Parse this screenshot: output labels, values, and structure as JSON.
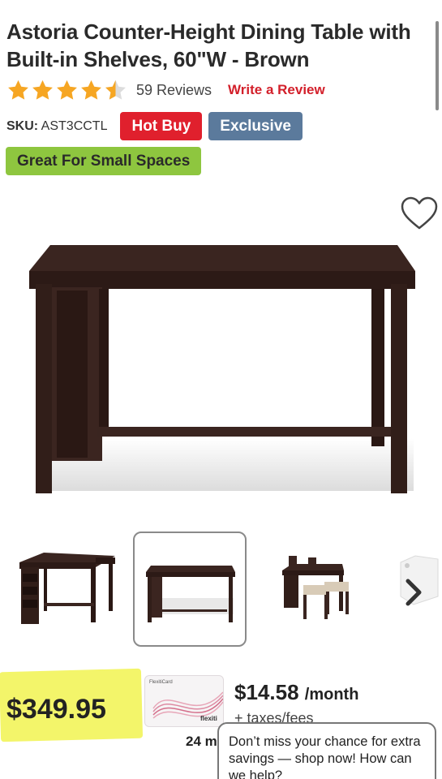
{
  "product": {
    "title": "Astoria Counter-Height Dining Table with Built-in Shelves, 60\"W - Brown",
    "rating": 4.5,
    "reviews_label": "59 Reviews",
    "write_review_label": "Write a Review",
    "sku_label": "SKU:",
    "sku_value": "AST3CCTL",
    "badges": [
      "Hot Buy",
      "Exclusive",
      "Great For Small Spaces"
    ]
  },
  "colors": {
    "star": "#f6a623",
    "hot_buy": "#e0202d",
    "exclusive": "#5b7a9c",
    "small_spaces": "#8ec63f",
    "review_link": "#d3202b",
    "price_highlight": "#f3f56a"
  },
  "icons": {
    "favorite": "heart-outline-icon",
    "next": "chevron-right-icon"
  },
  "gallery": {
    "selected_index": 1,
    "thumb_count": 4
  },
  "pricing": {
    "price": "$349.95",
    "monthly_amount": "$14.58",
    "monthly_unit": "/month",
    "taxes_label": "+ taxes/fees",
    "term_label": "24 m",
    "card": {
      "label": "FlexitiCard",
      "brand": "flexiti"
    }
  },
  "chat": {
    "message": "Don’t miss your chance for extra savings — shop now! How can we help?"
  }
}
